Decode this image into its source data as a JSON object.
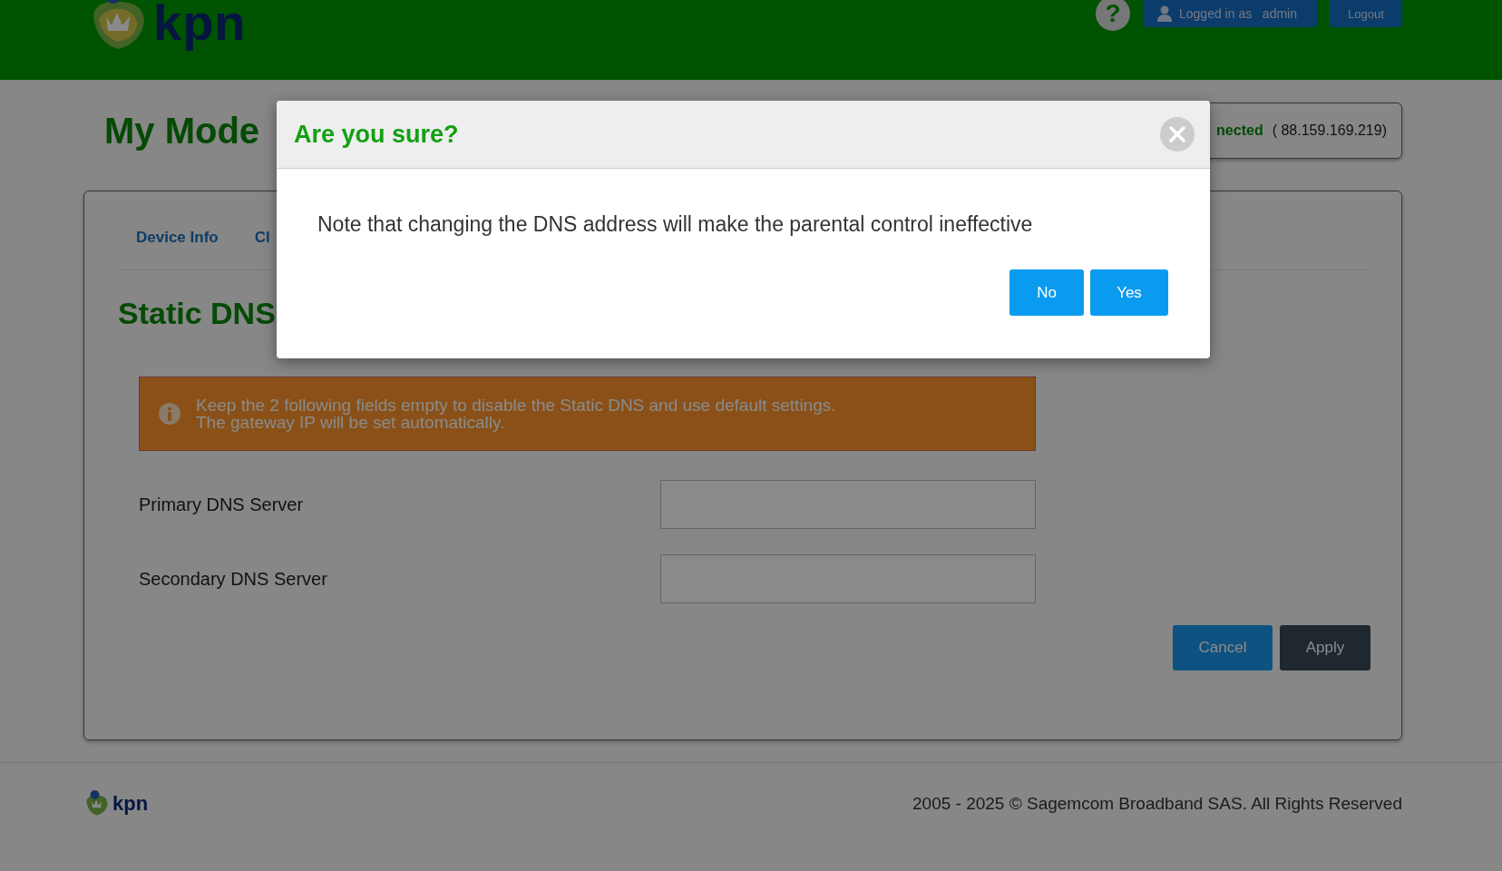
{
  "header": {
    "logo_text": "kpn",
    "help_icon": "?",
    "user": {
      "label": "Logged in as",
      "name": "admin"
    },
    "logout": "Logout"
  },
  "page_title": "My Mode",
  "connection": {
    "status": "nected",
    "ip": "( 88.159.169.219)"
  },
  "tabs": [
    {
      "label": "Device Info",
      "selected": false
    },
    {
      "label": "Cl",
      "selected": false
    }
  ],
  "section_title": "Static DNS",
  "notice": [
    "Keep the 2 following fields empty to disable the Static DNS and use default settings.",
    "The gateway IP will be set automatically."
  ],
  "fields": [
    {
      "label": "Primary DNS Server"
    },
    {
      "label": "Secondary DNS Server"
    }
  ],
  "form_buttons": [
    {
      "label": "Cancel",
      "kind": "secondary"
    },
    {
      "label": "Apply",
      "kind": "primary"
    }
  ],
  "footer": {
    "logo_text": "kpn",
    "copyright": "2005 - 2025 © Sagemcom Broadband SAS. All Rights Reserved"
  },
  "dialog": {
    "title": "Are you sure?",
    "message": "Note that changing the DNS address will make the parental control ineffective",
    "buttons": [
      "No",
      "Yes"
    ]
  }
}
